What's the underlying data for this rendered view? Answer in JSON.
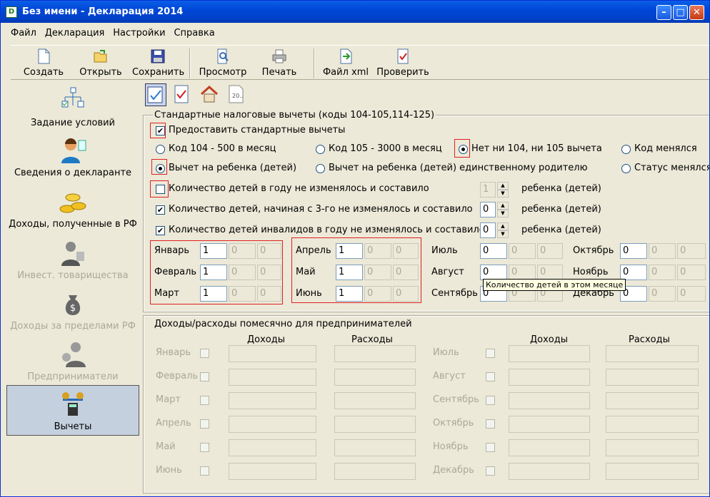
{
  "window": {
    "title": "Без имени - Декларация 2014"
  },
  "menu": [
    "Файл",
    "Декларация",
    "Настройки",
    "Справка"
  ],
  "toolbar": {
    "create": "Создать",
    "open": "Открыть",
    "save": "Сохранить",
    "preview": "Просмотр",
    "print": "Печать",
    "xml": "Файл xml",
    "check": "Проверить"
  },
  "nav": {
    "conditions": "Задание условий",
    "declarant": "Сведения о декларанте",
    "income_rf": "Доходы, полученные в РФ",
    "invest": "Инвест. товарищества",
    "income_abroad": "Доходы за пределами РФ",
    "entrepreneurs": "Предприниматели",
    "deductions": "Вычеты"
  },
  "std": {
    "title": "Стандартные налоговые вычеты (коды 104-105,114-125)",
    "provide": "Предоставить стандартные вычеты",
    "r1": "Код 104 - 500 в месяц",
    "r2": "Код 105 - 3000 в месяц",
    "r3": "Нет ни 104, ни 105 вычета",
    "r4": "Код менялся",
    "c1": "Вычет на ребенка (детей)",
    "c2": "Вычет на ребенка (детей) единственному родителю",
    "c3": "Статус менялся",
    "k1": "Количество детей в году не изменялось и составило",
    "k2": "Количество детей, начиная с 3-го не изменялось и составило",
    "k3": "Количество детей инвалидов в году не изменялось и составило",
    "v1": "1",
    "v2": "0",
    "v3": "0",
    "unit": "ребенка (детей)",
    "tooltip": "Количество детей в этом месяце"
  },
  "months": [
    {
      "name": "Январь",
      "v": "1"
    },
    {
      "name": "Февраль",
      "v": "1"
    },
    {
      "name": "Март",
      "v": "1"
    },
    {
      "name": "Апрель",
      "v": "1"
    },
    {
      "name": "Май",
      "v": "1"
    },
    {
      "name": "Июнь",
      "v": "1"
    },
    {
      "name": "Июль",
      "v": "0"
    },
    {
      "name": "Август",
      "v": "0"
    },
    {
      "name": "Сентябрь",
      "v": "0"
    },
    {
      "name": "Октябрь",
      "v": "0"
    },
    {
      "name": "Ноябрь",
      "v": "0"
    },
    {
      "name": "Декабрь",
      "v": "0"
    }
  ],
  "zero": "0",
  "ent": {
    "title": "Доходы/расходы помесячно для предпринимателей",
    "income": "Доходы",
    "expense": "Расходы",
    "left": [
      "Январь",
      "Февраль",
      "Март",
      "Апрель",
      "Май",
      "Июнь"
    ],
    "right": [
      "Июль",
      "Август",
      "Сентябрь",
      "Октябрь",
      "Ноябрь",
      "Декабрь"
    ]
  },
  "colors": {
    "title_bar": "#0047d8",
    "window_bg": "#ece9d8",
    "highlight": "#e02020"
  }
}
